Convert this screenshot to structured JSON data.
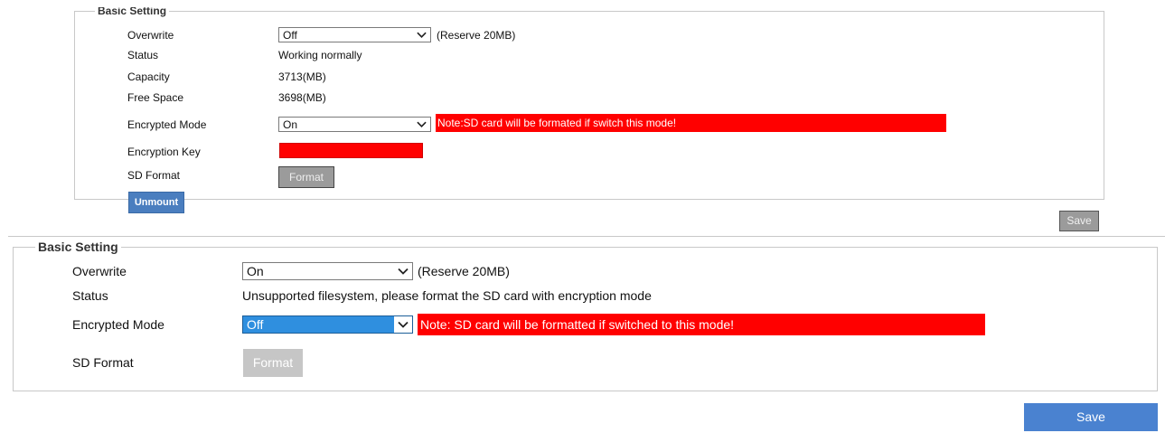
{
  "panel_top": {
    "legend": "Basic Setting",
    "overwrite": {
      "label": "Overwrite",
      "value": "Off",
      "hint": "(Reserve 20MB)"
    },
    "status": {
      "label": "Status",
      "value": "Working normally"
    },
    "capacity": {
      "label": "Capacity",
      "value": "3713(MB)"
    },
    "free_space": {
      "label": "Free Space",
      "value": "3698(MB)"
    },
    "encrypted_mode": {
      "label": "Encrypted Mode",
      "value": "On",
      "note": "Note:SD card will be formated if switch this mode!"
    },
    "encryption_key": {
      "label": "Encryption Key",
      "value": ""
    },
    "sd_format": {
      "label": "SD Format",
      "button": "Format"
    },
    "unmount_button": "Unmount",
    "save_button": "Save"
  },
  "panel_bottom": {
    "legend": "Basic Setting",
    "overwrite": {
      "label": "Overwrite",
      "value": "On",
      "hint": "(Reserve 20MB)"
    },
    "status": {
      "label": "Status",
      "value": "Unsupported filesystem, please format the SD card with encryption mode"
    },
    "encrypted_mode": {
      "label": "Encrypted Mode",
      "value": "Off",
      "note": "Note: SD card will be formatted if switched to this mode!"
    },
    "sd_format": {
      "label": "SD Format",
      "button": "Format"
    },
    "save_button": "Save"
  },
  "colors": {
    "warning_red": "#ff0000",
    "accent_blue": "#4a82d0",
    "disabled_gray": "#c6c6c6",
    "selection_blue": "#2f8fdf"
  },
  "icons": {
    "dropdown": "chevron-down-icon"
  }
}
